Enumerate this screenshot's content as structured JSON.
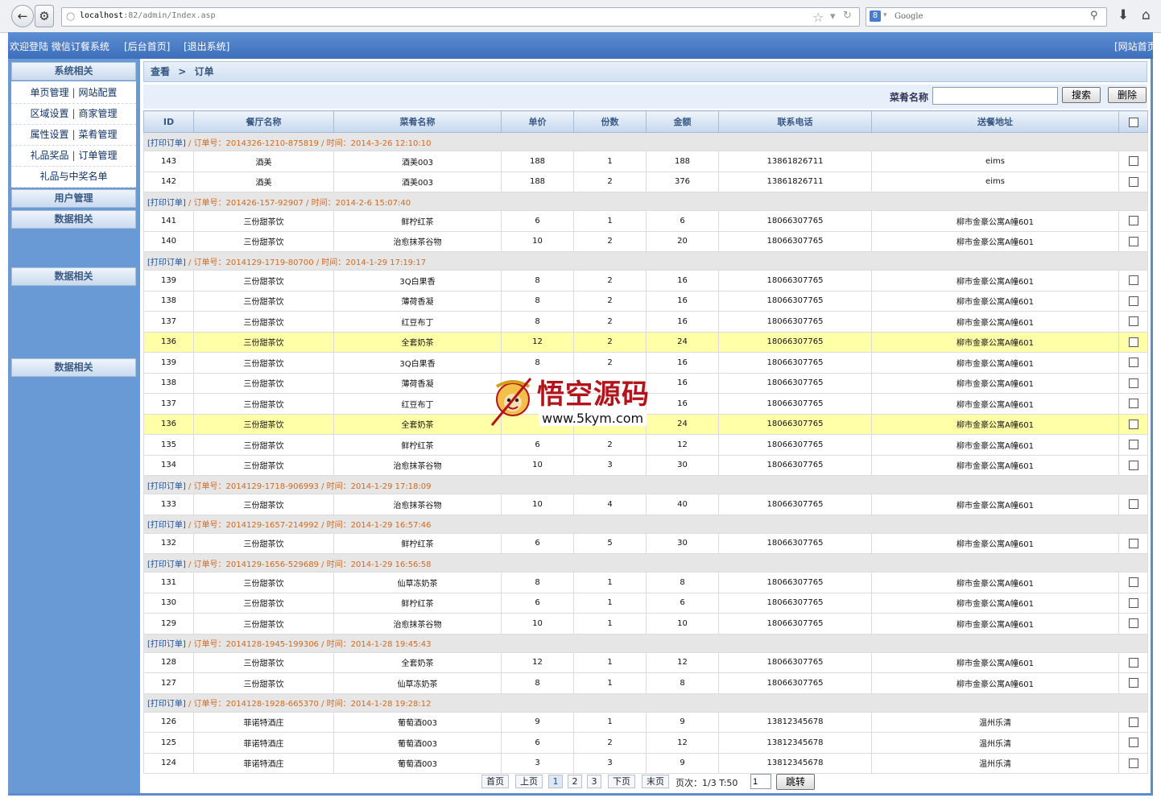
{
  "browser": {
    "url_host": "localhost",
    "url_path": ":82/admin/Index.asp",
    "search_placeholder": "Google"
  },
  "header": {
    "welcome": "欢迎登陆 微信订餐系统",
    "home_link": "[后台首页]",
    "logout_link": "[退出系统]",
    "site_link": "[网站首页"
  },
  "sidebar": {
    "system_title": "系统相关",
    "links": [
      {
        "a": "单页管理",
        "b": "网站配置"
      },
      {
        "a": "区域设置",
        "b": "商家管理"
      },
      {
        "a": "属性设置",
        "b": "菜肴管理"
      },
      {
        "a": "礼品奖品",
        "b": "订单管理"
      },
      {
        "a": "礼品与中奖名单",
        "b": ""
      }
    ],
    "user_mgmt": "用户管理",
    "data_title_1": "数据相关",
    "data_title_2": "数据相关",
    "data_title_3": "数据相关"
  },
  "breadcrumb": {
    "view": "查看",
    "arrow": ">",
    "current": "订单"
  },
  "search": {
    "label": "菜肴名称",
    "value": "",
    "search_btn": "搜索",
    "delete_btn": "删除"
  },
  "table": {
    "headers": [
      "ID",
      "餐厅名称",
      "菜肴名称",
      "单价",
      "份数",
      "金额",
      "联系电话",
      "送餐地址"
    ],
    "print_label": "[打印订单]",
    "order_label": "订单号：",
    "time_label": "时间：",
    "rows": [
      {
        "type": "group",
        "order": "2014326-1210-875819",
        "time": "2014-3-26 12:10:10"
      },
      {
        "type": "item",
        "id": "143",
        "restaurant": "酒美",
        "dish": "酒美003",
        "price": "188",
        "qty": "1",
        "amount": "188",
        "phone": "13861826711",
        "address": "eims"
      },
      {
        "type": "item",
        "id": "142",
        "restaurant": "酒美",
        "dish": "酒美003",
        "price": "188",
        "qty": "2",
        "amount": "376",
        "phone": "13861826711",
        "address": "eims"
      },
      {
        "type": "group",
        "order": "201426-157-92907",
        "time": "2014-2-6 15:07:40"
      },
      {
        "type": "item",
        "id": "141",
        "restaurant": "三份甜茶饮",
        "dish": "鲜柠红茶",
        "price": "6",
        "qty": "1",
        "amount": "6",
        "phone": "18066307765",
        "address": "柳市金豪公寓A幢601"
      },
      {
        "type": "item",
        "id": "140",
        "restaurant": "三份甜茶饮",
        "dish": "治愈抹茶谷物",
        "price": "10",
        "qty": "2",
        "amount": "20",
        "phone": "18066307765",
        "address": "柳市金豪公寓A幢601"
      },
      {
        "type": "group",
        "order": "2014129-1719-80700",
        "time": "2014-1-29 17:19:17"
      },
      {
        "type": "item",
        "id": "139",
        "restaurant": "三份甜茶饮",
        "dish": "3Q白果香",
        "price": "8",
        "qty": "2",
        "amount": "16",
        "phone": "18066307765",
        "address": "柳市金豪公寓A幢601"
      },
      {
        "type": "item",
        "id": "138",
        "restaurant": "三份甜茶饮",
        "dish": "薄荷香凝",
        "price": "8",
        "qty": "2",
        "amount": "16",
        "phone": "18066307765",
        "address": "柳市金豪公寓A幢601"
      },
      {
        "type": "item",
        "id": "137",
        "restaurant": "三份甜茶饮",
        "dish": "红豆布丁",
        "price": "8",
        "qty": "2",
        "amount": "16",
        "phone": "18066307765",
        "address": "柳市金豪公寓A幢601"
      },
      {
        "type": "item",
        "hl": true,
        "id": "136",
        "restaurant": "三份甜茶饮",
        "dish": "全套奶茶",
        "price": "12",
        "qty": "2",
        "amount": "24",
        "phone": "18066307765",
        "address": "柳市金豪公寓A幢601"
      },
      {
        "type": "item",
        "id": "139",
        "restaurant": "三份甜茶饮",
        "dish": "3Q白果香",
        "price": "8",
        "qty": "2",
        "amount": "16",
        "phone": "18066307765",
        "address": "柳市金豪公寓A幢601"
      },
      {
        "type": "item",
        "id": "138",
        "restaurant": "三份甜茶饮",
        "dish": "薄荷香凝",
        "price": "",
        "qty": "",
        "amount": "16",
        "phone": "18066307765",
        "address": "柳市金豪公寓A幢601"
      },
      {
        "type": "item",
        "id": "137",
        "restaurant": "三份甜茶饮",
        "dish": "红豆布丁",
        "price": "",
        "qty": "",
        "amount": "16",
        "phone": "18066307765",
        "address": "柳市金豪公寓A幢601"
      },
      {
        "type": "item",
        "hl": true,
        "id": "136",
        "restaurant": "三份甜茶饮",
        "dish": "全套奶茶",
        "price": "",
        "qty": "",
        "amount": "24",
        "phone": "18066307765",
        "address": "柳市金豪公寓A幢601"
      },
      {
        "type": "item",
        "id": "135",
        "restaurant": "三份甜茶饮",
        "dish": "鲜柠红茶",
        "price": "6",
        "qty": "2",
        "amount": "12",
        "phone": "18066307765",
        "address": "柳市金豪公寓A幢601"
      },
      {
        "type": "item",
        "id": "134",
        "restaurant": "三份甜茶饮",
        "dish": "治愈抹茶谷物",
        "price": "10",
        "qty": "3",
        "amount": "30",
        "phone": "18066307765",
        "address": "柳市金豪公寓A幢601"
      },
      {
        "type": "group",
        "order": "2014129-1718-906993",
        "time": "2014-1-29 17:18:09"
      },
      {
        "type": "item",
        "id": "133",
        "restaurant": "三份甜茶饮",
        "dish": "治愈抹茶谷物",
        "price": "10",
        "qty": "4",
        "amount": "40",
        "phone": "18066307765",
        "address": "柳市金豪公寓A幢601"
      },
      {
        "type": "group",
        "order": "2014129-1657-214992",
        "time": "2014-1-29 16:57:46"
      },
      {
        "type": "item",
        "id": "132",
        "restaurant": "三份甜茶饮",
        "dish": "鲜柠红茶",
        "price": "6",
        "qty": "5",
        "amount": "30",
        "phone": "18066307765",
        "address": "柳市金豪公寓A幢601"
      },
      {
        "type": "group",
        "order": "2014129-1656-529689",
        "time": "2014-1-29 16:56:58"
      },
      {
        "type": "item",
        "id": "131",
        "restaurant": "三份甜茶饮",
        "dish": "仙草冻奶茶",
        "price": "8",
        "qty": "1",
        "amount": "8",
        "phone": "18066307765",
        "address": "柳市金豪公寓A幢601"
      },
      {
        "type": "item",
        "id": "130",
        "restaurant": "三份甜茶饮",
        "dish": "鲜柠红茶",
        "price": "6",
        "qty": "1",
        "amount": "6",
        "phone": "18066307765",
        "address": "柳市金豪公寓A幢601"
      },
      {
        "type": "item",
        "id": "129",
        "restaurant": "三份甜茶饮",
        "dish": "治愈抹茶谷物",
        "price": "10",
        "qty": "1",
        "amount": "10",
        "phone": "18066307765",
        "address": "柳市金豪公寓A幢601"
      },
      {
        "type": "group",
        "order": "2014128-1945-199306",
        "time": "2014-1-28 19:45:43"
      },
      {
        "type": "item",
        "id": "128",
        "restaurant": "三份甜茶饮",
        "dish": "全套奶茶",
        "price": "12",
        "qty": "1",
        "amount": "12",
        "phone": "18066307765",
        "address": "柳市金豪公寓A幢601"
      },
      {
        "type": "item",
        "id": "127",
        "restaurant": "三份甜茶饮",
        "dish": "仙草冻奶茶",
        "price": "8",
        "qty": "1",
        "amount": "8",
        "phone": "18066307765",
        "address": "柳市金豪公寓A幢601"
      },
      {
        "type": "group",
        "order": "2014128-1928-665370",
        "time": "2014-1-28 19:28:12"
      },
      {
        "type": "item",
        "id": "126",
        "restaurant": "菲诺特酒庄",
        "dish": "葡萄酒003",
        "price": "9",
        "qty": "1",
        "amount": "9",
        "phone": "13812345678",
        "address": "温州乐清"
      },
      {
        "type": "item",
        "id": "125",
        "restaurant": "菲诺特酒庄",
        "dish": "葡萄酒003",
        "price": "6",
        "qty": "2",
        "amount": "12",
        "phone": "13812345678",
        "address": "温州乐清"
      },
      {
        "type": "item",
        "id": "124",
        "restaurant": "菲诺特酒庄",
        "dish": "葡萄酒003",
        "price": "3",
        "qty": "3",
        "amount": "9",
        "phone": "13812345678",
        "address": "温州乐清"
      }
    ]
  },
  "pager": {
    "first": "首页",
    "prev": "上页",
    "pages": [
      "1",
      "2",
      "3"
    ],
    "current": "1",
    "next": "下页",
    "last": "末页",
    "info": "页次：1/3 T:50",
    "input_value": "1",
    "jump": "跳转"
  },
  "watermark": {
    "title": "悟空源码",
    "url": "www.5kym.com"
  },
  "colors": {
    "header_blue": "#4a7cc4",
    "sidebar_blue": "#6a9ad5",
    "highlight": "#ffffa8",
    "group_text": "#d2691e"
  }
}
